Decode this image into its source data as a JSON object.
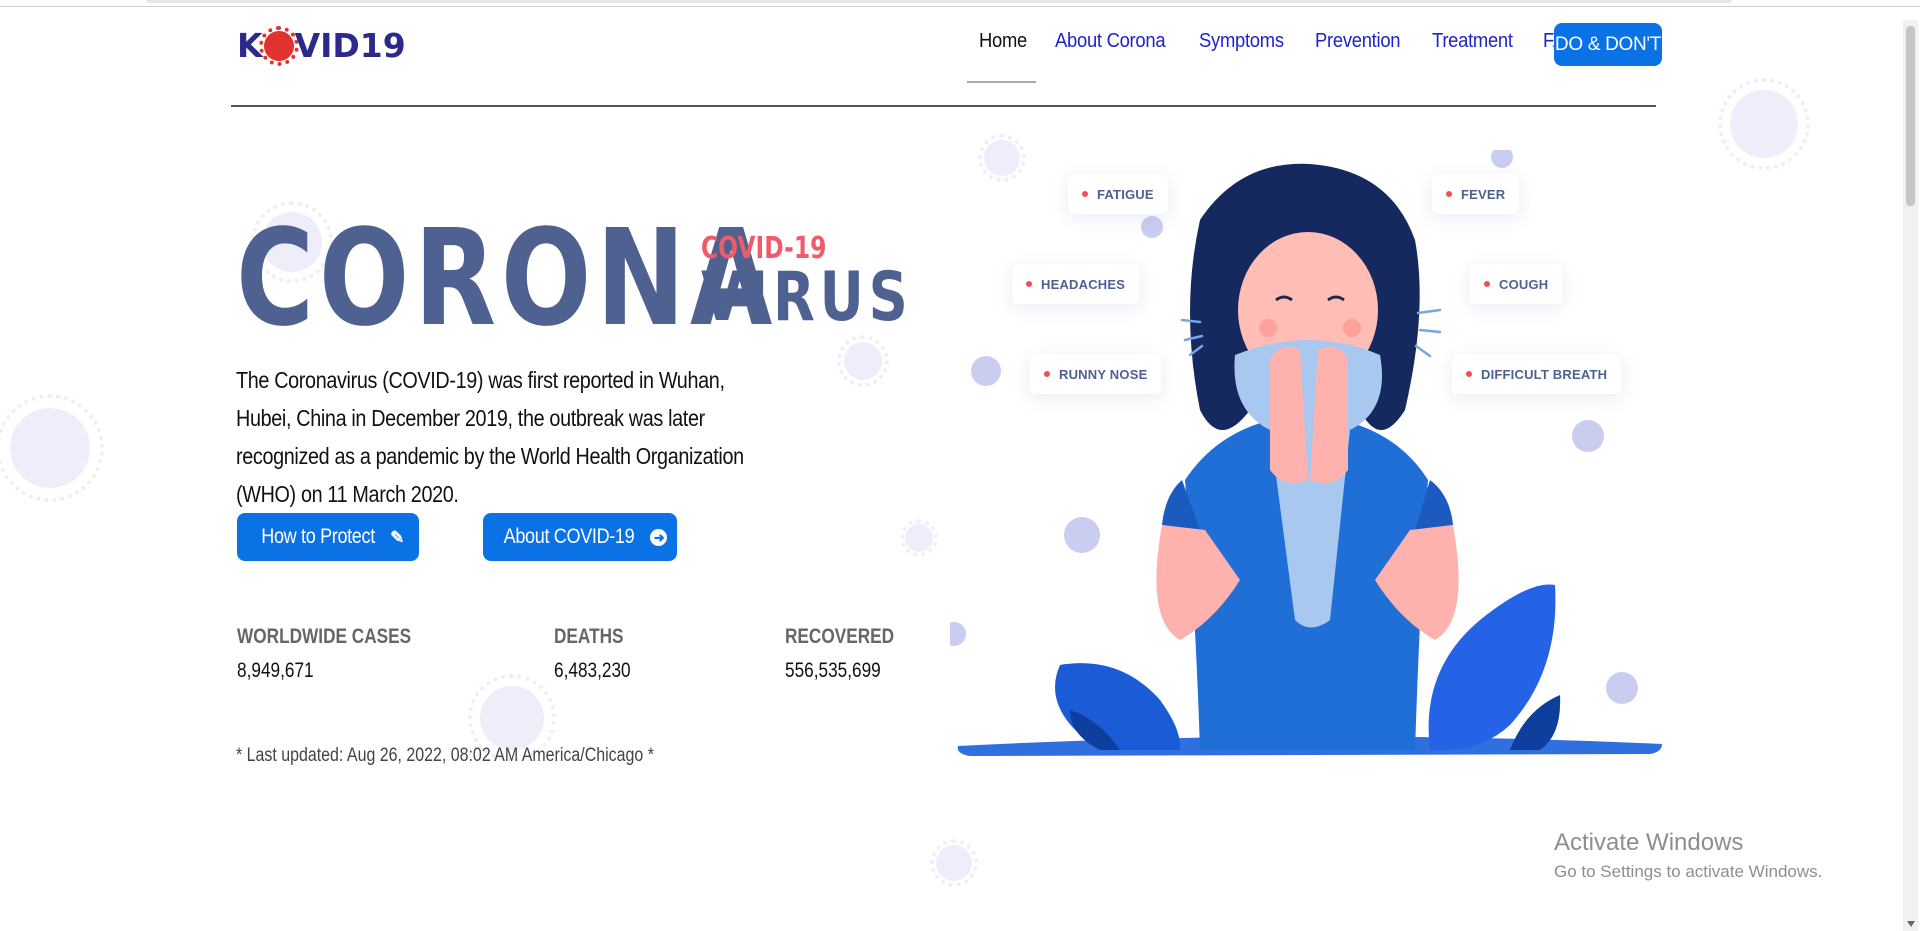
{
  "brand": {
    "logo_left": "K",
    "logo_right": "VID19"
  },
  "nav": {
    "items": [
      {
        "label": "Home"
      },
      {
        "label": "About Corona"
      },
      {
        "label": "Symptoms"
      },
      {
        "label": "Prevention"
      },
      {
        "label": "Treatment"
      },
      {
        "label": "FAQ"
      }
    ],
    "cta": "DO & DON'T"
  },
  "hero": {
    "title_main": "CORONA",
    "title_small": "COVID-19",
    "title_side": "VIRUS",
    "description": "The Coronavirus (COVID-19) was first reported in Wuhan, Hubei, China in December 2019, the outbreak was later recognized as a pandemic by the World Health Organization (WHO) on 11 March 2020.",
    "buttons": {
      "protect": "How to Protect",
      "about": "About COVID-19"
    }
  },
  "stats": [
    {
      "label": "WORLDWIDE CASES",
      "value": "8,949,671"
    },
    {
      "label": "DEATHS",
      "value": "6,483,230"
    },
    {
      "label": "RECOVERED",
      "value": "556,535,699"
    }
  ],
  "last_updated": "* Last updated: Aug 26, 2022, 08:02 AM America/Chicago *",
  "symptoms": {
    "fatigue": "FATIGUE",
    "fever": "FEVER",
    "headaches": "HEADACHES",
    "cough": "COUGH",
    "runny_nose": "RUNNY NOSE",
    "difficult_breath": "DIFFICULT BREATH"
  },
  "windows_watermark": {
    "title": "Activate Windows",
    "subtitle": "Go to Settings to activate Windows."
  },
  "colors": {
    "accent": "#0b72e6",
    "heading": "#4f6190",
    "highlight": "#ef5b6a",
    "logo": "#2b2a8c"
  }
}
